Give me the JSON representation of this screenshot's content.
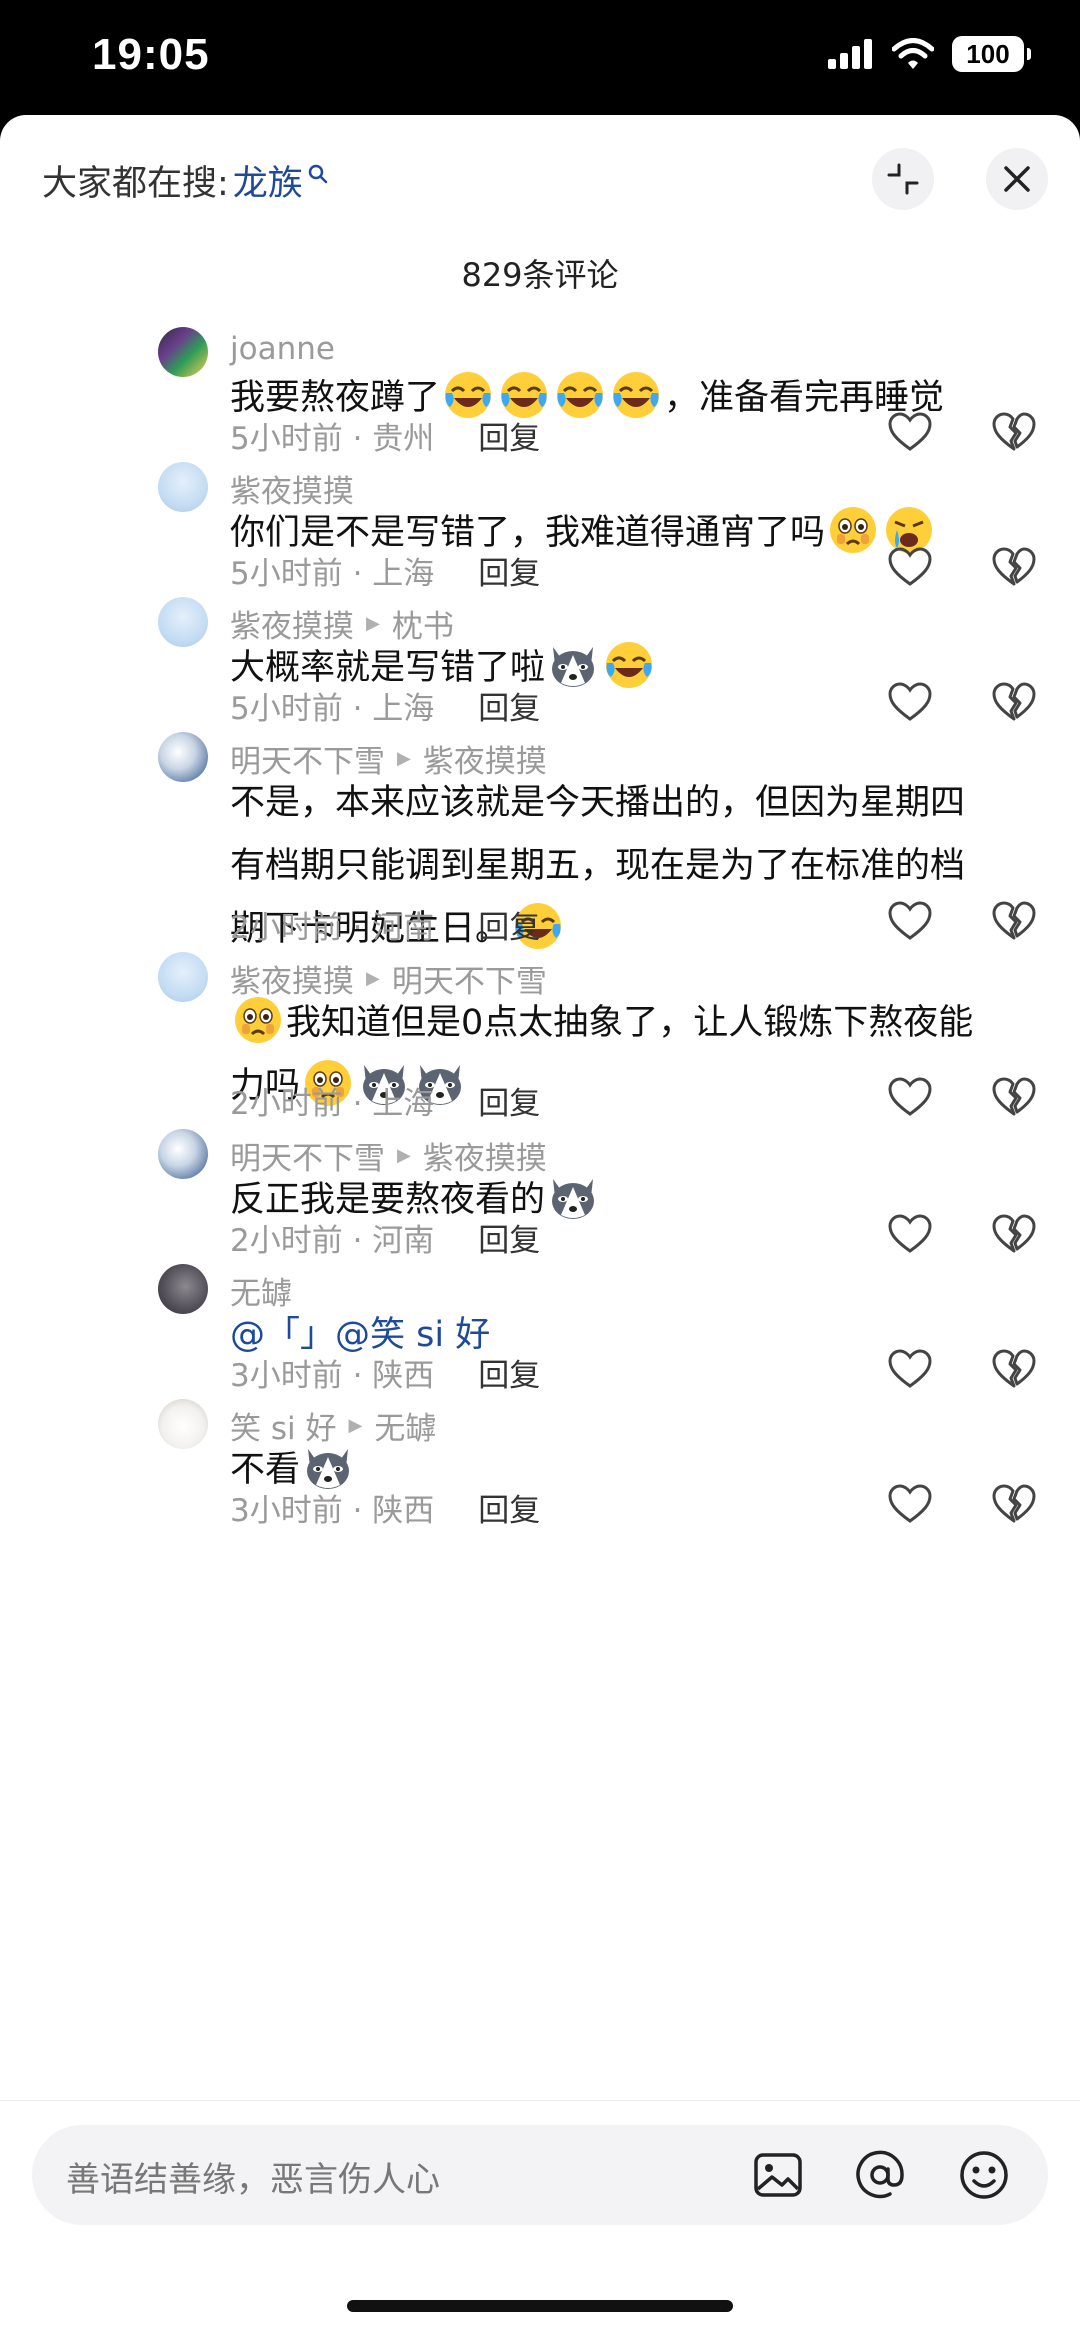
{
  "status": {
    "time": "19:05",
    "battery": "100"
  },
  "header": {
    "hint_prefix": "大家都在搜:",
    "search_term": "龙族"
  },
  "comments_count": "829条评论",
  "comments": [
    {
      "user": "joanne",
      "text": "我要熬夜蹲了",
      "text_after": "，准备看完再睡觉",
      "time_loc": "5小时前 · 贵州",
      "reply": "回复"
    },
    {
      "user": "紫夜摸摸",
      "text": "你们是不是写错了，我难道得通宵了吗",
      "time_loc": "5小时前 · 上海",
      "reply": "回复"
    },
    {
      "user": "紫夜摸摸",
      "reply_to": "枕书",
      "text": "大概率就是写错了啦",
      "time_loc": "5小时前 · 上海",
      "reply": "回复"
    },
    {
      "user": "明天不下雪",
      "reply_to": "紫夜摸摸",
      "text_line1": "不是，本来应该就是今天播出的，但因为星期四",
      "text_line2": "有档期只能调到星期五，现在是为了在标准的档",
      "text_line3": "期下卡明妃生日。",
      "time_loc": "2小时前 · 河南",
      "reply": "回复"
    },
    {
      "user": "紫夜摸摸",
      "reply_to": "明天不下雪",
      "text_line1": "我知道但是0点太抽象了，让人锻炼下熬夜能",
      "text_line2": "力吗",
      "time_loc": "2小时前 · 上海",
      "reply": "回复"
    },
    {
      "user": "明天不下雪",
      "reply_to": "紫夜摸摸",
      "text": "反正我是要熬夜看的",
      "time_loc": "2小时前 · 河南",
      "reply": "回复"
    },
    {
      "user": "无罅",
      "text": "@「」@笑 si 好",
      "time_loc": "3小时前 · 陕西",
      "reply": "回复"
    },
    {
      "user": "笑 si 好",
      "reply_to": "无罅",
      "text": "不看",
      "time_loc": "3小时前 · 陕西",
      "reply": "回复"
    }
  ],
  "input": {
    "placeholder": "善语结善缘，恶言伤人心"
  },
  "icons": [
    "search-icon",
    "collapse-icon",
    "close-icon",
    "heart-icon",
    "broken-heart-icon",
    "image-icon",
    "at-icon",
    "emoji-icon"
  ]
}
